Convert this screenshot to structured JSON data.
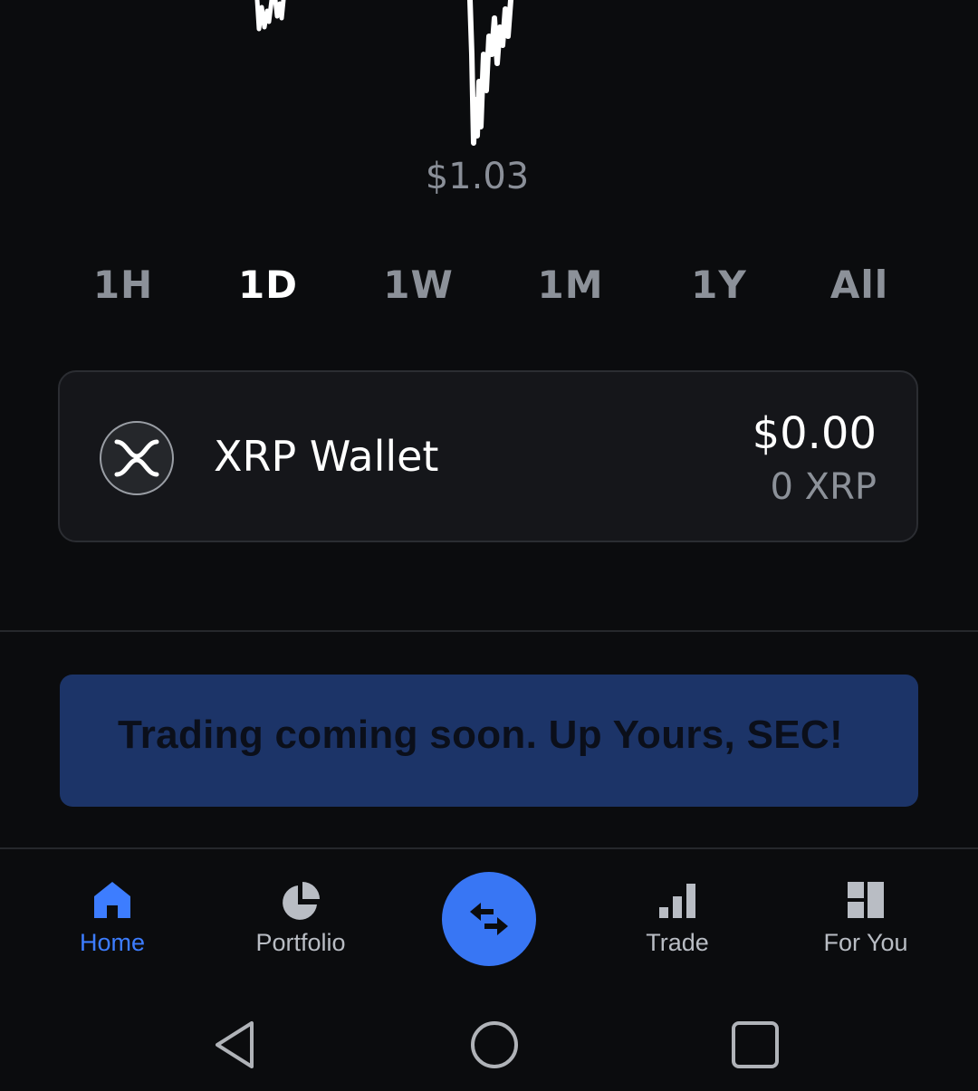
{
  "chart": {
    "low_label": "$1.03",
    "line_color": "#ffffff"
  },
  "ranges": [
    {
      "label": "1H",
      "active": false
    },
    {
      "label": "1D",
      "active": true
    },
    {
      "label": "1W",
      "active": false
    },
    {
      "label": "1M",
      "active": false
    },
    {
      "label": "1Y",
      "active": false
    },
    {
      "label": "All",
      "active": false
    }
  ],
  "wallet": {
    "name": "XRP Wallet",
    "usd_value": "$0.00",
    "amount": "0 XRP",
    "logo_icon": "xrp-logo-icon"
  },
  "banner": {
    "text": "Trading coming soon.  Up Yours, SEC!",
    "bg_color": "#1c3468"
  },
  "nav": {
    "items": [
      {
        "label": "Home",
        "icon": "home-icon",
        "active": true
      },
      {
        "label": "Portfolio",
        "icon": "pie-chart-icon",
        "active": false
      },
      {
        "label": "",
        "icon": "swap-arrows-icon",
        "active": false
      },
      {
        "label": "Trade",
        "icon": "bar-chart-icon",
        "active": false
      },
      {
        "label": "For You",
        "icon": "dashboard-icon",
        "active": false
      }
    ],
    "accent_color": "#3d7dff",
    "swap_button_color": "#3876f4"
  },
  "system_nav": {
    "icons": [
      "back-triangle-icon",
      "home-circle-icon",
      "recents-square-icon"
    ]
  }
}
